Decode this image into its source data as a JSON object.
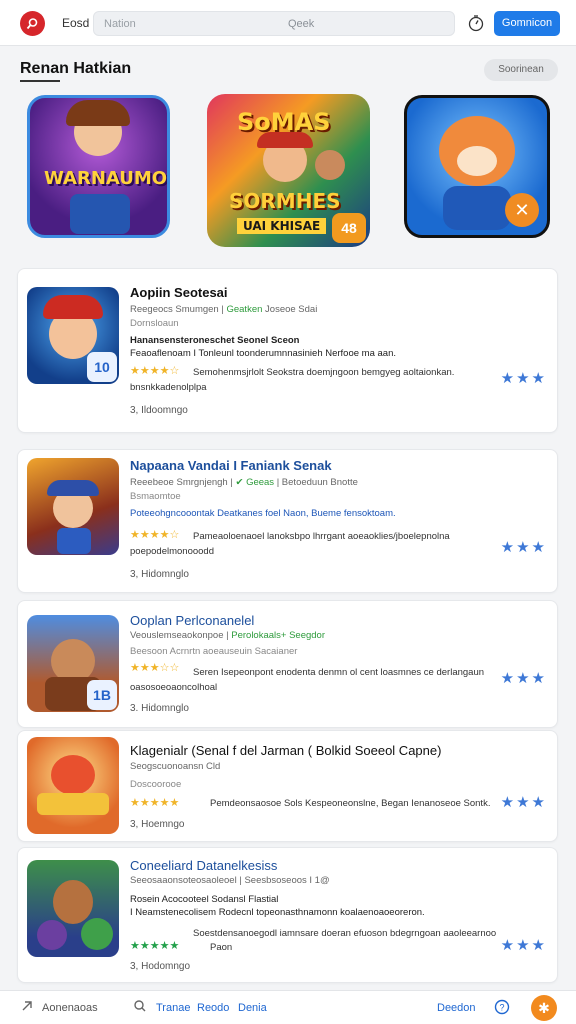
{
  "header": {
    "brand": "Eosd",
    "search_placeholder": "Nation",
    "search_label": "Qeek",
    "connect_label": "Gomnicon"
  },
  "featured": {
    "title": "Renan Hatkian",
    "button": "Soorinean",
    "items": [
      {
        "name": "featured-game-1",
        "art_text": "WARNAUMO"
      },
      {
        "name": "featured-game-2",
        "art_top": "SoMAS",
        "art_mid": "SORMHES",
        "art_bot": "UAI KHISAE",
        "badge": "48"
      },
      {
        "name": "featured-game-3",
        "badge": "✕"
      }
    ]
  },
  "apps": [
    {
      "title": "Aopiin Seotesai",
      "meta_a": "Reegeocs Smumgen |",
      "meta_green": "Geatken",
      "meta_b": "Joseoe Sdai",
      "sub": "Dornsloaun",
      "desc1": "Hanansensteroneschet Seonel Sceon",
      "desc2": "Feaoaflenoam I Tonleunl toonderumnnasinieh Nerfooe ma aan.",
      "review": "Semohenmsjrlolt Seokstra doemjngoon bemgyeg aoltaionkan.",
      "review2": "bnsnkkadenolplpa",
      "footer": "3, Ildoomngo",
      "badge": "10",
      "stars": "★★★★☆",
      "rating": "★★★"
    },
    {
      "title": "Napaana Vandai I Faniank Senak",
      "meta_a": "Reeebeoe Smrgnjengh |",
      "meta_green": "✔ Geeas",
      "meta_b": "| Betoeduun Bnotte",
      "sub": "Bsmaomtoe",
      "desc1": "Poteeohgncooontak Deatkanes foel Naon, Bueme fensoktoam.",
      "review": "Pameaoloenaoel lanoksbpo lhrrgant aoeaoklies/jboelepnolna",
      "review2": "poepodelmonooodd",
      "footer": "3, Hidomnglo",
      "stars": "★★★★☆",
      "rating": "★★★"
    },
    {
      "title": "Ooplan Perlconanelel",
      "meta_a": "Veouslemseaokonpoe |",
      "meta_green": "Perolokaals+ Seegdor",
      "sub": "Beesoon Acrnrtn aoeauseuin Sacaianer",
      "review": "Seren Isepeonpont enodenta denmn ol cent loasmnes ce derlangaun",
      "review2": "oasosoeoaoncolhoal",
      "footer": "3. Hidomnglo",
      "badge": "1B",
      "stars": "★★★☆☆",
      "rating": "★★★"
    },
    {
      "title": "Klagenialr (Senal f del Jarman ( Bolkid Soeeol Capne)",
      "meta_a": "Seogscuonoansn Cld",
      "sub": "Doscoorooe",
      "review": "Pemdeonsaosoe Sols Kespeoneonslne, Began Ienanoseoe Sontk.",
      "footer": "3, Hoemngo",
      "stars": "★★★★★",
      "rating": "★★★"
    },
    {
      "title": "Coneeliard Datanelkesiss",
      "meta_a": "Seeosaaonsoteosaoleoel | Seesbsoseoos I 1@",
      "desc1": "Rosein Acocooteel Sodansl Flastial",
      "desc2": "I Neamstenecolisem Rodecnl topeonasthnamonn koalaenoaoeoreron.",
      "review": "Soestdensanoegodl iamnsare doeran efuoson bdegrngoan aaoleearnoo",
      "review2": "Paon",
      "footer": "3, Hodomngo",
      "stars": "★★★★★",
      "rating": "★★★"
    }
  ],
  "bottom_nav": {
    "left": "Aonenaoas",
    "center1": "Tranae",
    "center2": "Reodo",
    "center3": "Denia",
    "right": "Deedon"
  }
}
